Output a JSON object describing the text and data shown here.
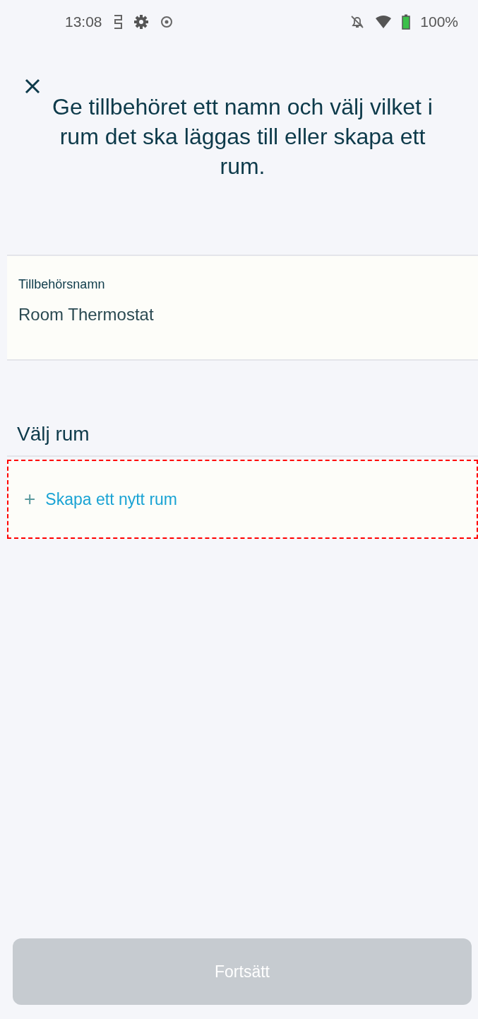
{
  "status_bar": {
    "time": "13:08",
    "battery": "100%"
  },
  "header": {
    "title": "Ge tillbehöret ett namn och välj vilket i rum det ska läggas till eller skapa ett rum."
  },
  "name_field": {
    "label": "Tillbehörsnamn",
    "value": "Room Thermostat"
  },
  "room_section": {
    "title": "Välj rum",
    "create_action": {
      "icon": "+",
      "label": "Skapa ett nytt rum",
      "highlighted": true
    }
  },
  "continue_button": {
    "label": "Fortsätt",
    "disabled": true
  }
}
